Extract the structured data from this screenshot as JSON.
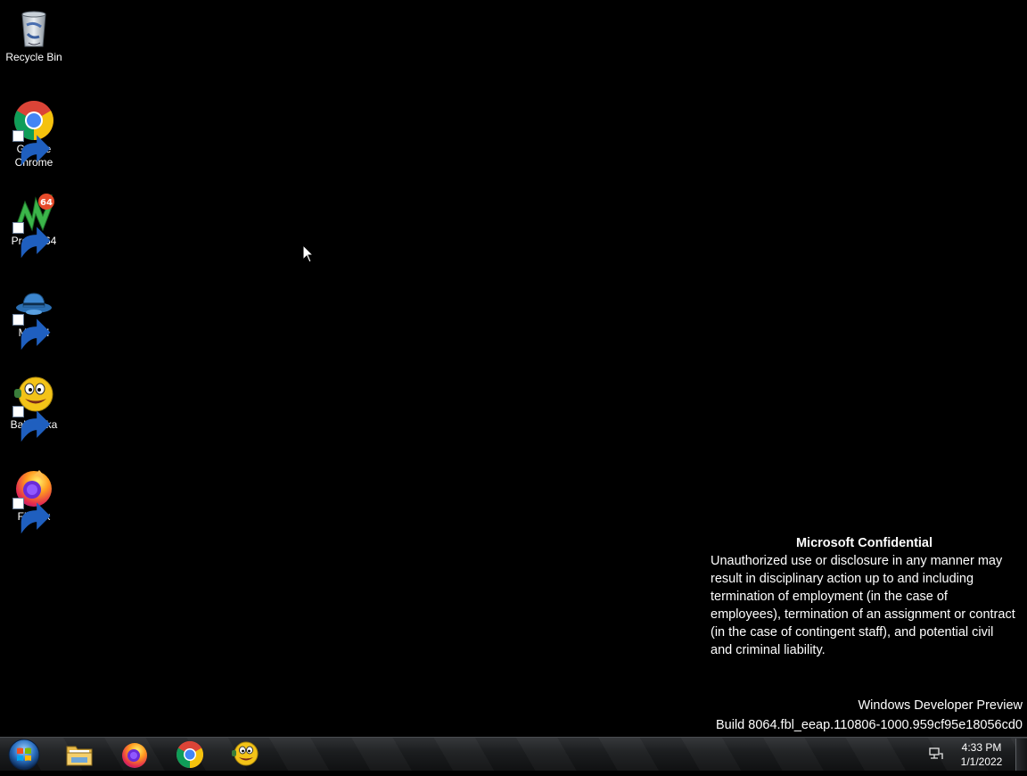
{
  "desktop": {
    "icons": [
      {
        "label": "Recycle Bin",
        "icon": "recycle-bin-icon",
        "shortcut": false
      },
      {
        "label": "Google Chrome",
        "icon": "chrome-icon",
        "shortcut": true
      },
      {
        "label": "Project64",
        "icon": "project64-icon",
        "shortcut": true
      },
      {
        "label": "MASH",
        "icon": "mash-icon",
        "shortcut": true
      },
      {
        "label": "Balabolka",
        "icon": "balabolka-icon",
        "shortcut": true
      },
      {
        "label": "Firefox",
        "icon": "firefox-icon",
        "shortcut": true
      }
    ],
    "confidential": {
      "title": "Microsoft Confidential",
      "body": "Unauthorized use or disclosure in any manner may result in disciplinary action up to and including termination of employment (in the case of employees), termination of an assignment or contract (in the case of contingent staff), and potential civil and criminal liability."
    },
    "watermark": {
      "line1": "Windows Developer Preview",
      "line2": "Build 8064.fbl_eeap.110806-1000.959cf95e18056cd0"
    }
  },
  "taskbar": {
    "start": "start-button-icon",
    "pinned": [
      "file-explorer-icon",
      "firefox-icon",
      "chrome-icon",
      "balabolka-icon"
    ],
    "tray": {
      "network_icon": "network-icon",
      "time": "4:33 PM",
      "date": "1/1/2022"
    }
  },
  "colors": {
    "desktop_bg": "#000000",
    "taskbar_bg": "#16181a",
    "text": "#ffffff"
  }
}
